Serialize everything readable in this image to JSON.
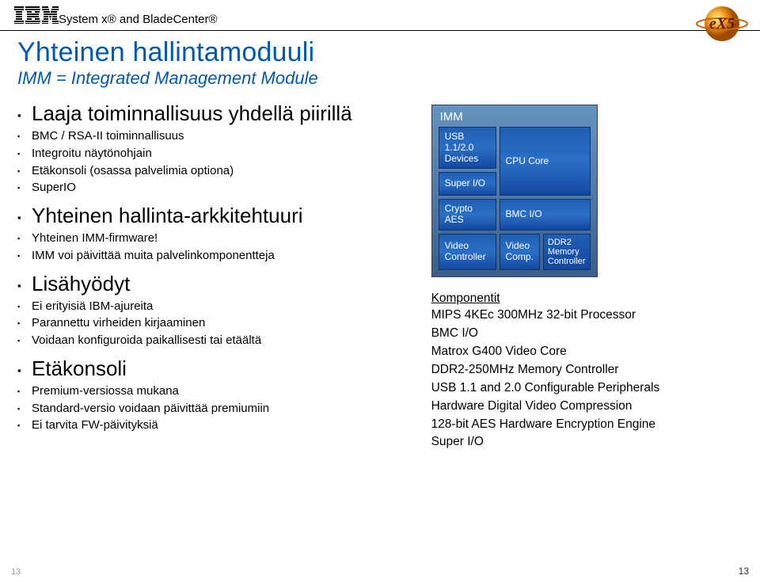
{
  "header": {
    "text": "System x® and BladeCenter®"
  },
  "title": "Yhteinen hallintamoduuli",
  "subtitle": "IMM = Integrated Management Module",
  "left": {
    "s1_head": "Laaja toiminnallisuus yhdellä piirillä",
    "s1_items": [
      "BMC / RSA-II toiminnallisuus",
      "Integroitu näytönohjain",
      "Etäkonsoli (osassa palvelimia optiona)",
      "SuperIO"
    ],
    "s2_head": "Yhteinen hallinta-arkkitehtuuri",
    "s2_items": [
      "Yhteinen IMM-firmware!",
      "IMM voi päivittää muita palvelinkomponentteja"
    ],
    "s3_head": "Lisähyödyt",
    "s3_items": [
      "Ei erityisiä IBM-ajureita",
      "Parannettu virheiden kirjaaminen",
      "Voidaan konfiguroida paikallisesti tai etäältä"
    ],
    "s4_head": "Etäkonsoli",
    "s4_items": [
      "Premium-versiossa mukana",
      "Standard-versio voidaan päivittää premiumiin",
      "Ei tarvita FW-päivityksiä"
    ]
  },
  "imm": {
    "label": "IMM",
    "usb": "USB 1.1/2.0 Devices",
    "cpu": "CPU Core",
    "superio": "Super I/O",
    "crypto": "Crypto AES",
    "bmcio": "BMC I/O",
    "vctrl": "Video Controller",
    "vcomp": "Video Comp.",
    "ddr2": "DDR2 Memory Controller"
  },
  "komp": {
    "title": "Komponentit",
    "lines": [
      "MIPS 4KEc 300MHz 32-bit Processor",
      "BMC I/O",
      "Matrox G400 Video Core",
      "DDR2-250MHz Memory Controller",
      "USB 1.1 and 2.0 Configurable Peripherals",
      "Hardware Digital Video Compression",
      "128-bit AES Hardware Encryption Engine",
      "Super I/O"
    ]
  },
  "page": {
    "left": "13",
    "right": "13"
  }
}
